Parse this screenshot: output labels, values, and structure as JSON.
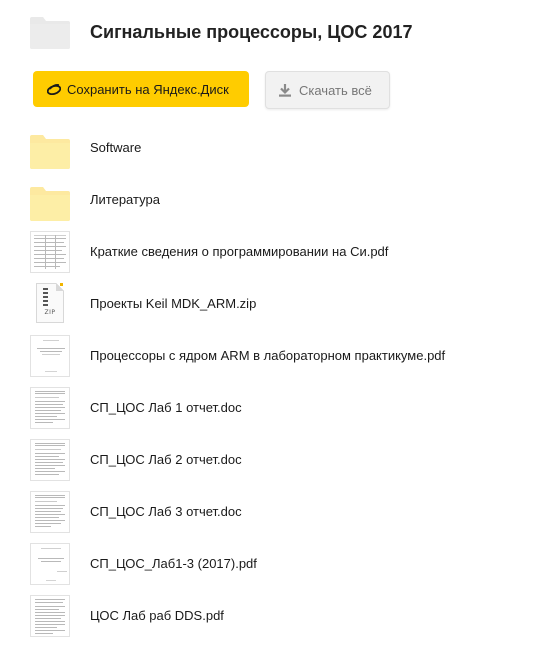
{
  "header": {
    "title": "Сигнальные процессоры, ЦОС 2017",
    "folder_icon": "folder-icon",
    "folder_color": "#e9e9e9"
  },
  "actions": {
    "save_label": "Сохранить на Яндекс.Диск",
    "save_color": "#ffcc00",
    "download_label": "Скачать всё",
    "download_color": "#f2f2f2"
  },
  "files": [
    {
      "name": "Software",
      "type": "folder",
      "icon": "folder-icon"
    },
    {
      "name": "Литература",
      "type": "folder",
      "icon": "folder-icon"
    },
    {
      "name": "Краткие сведения о программировании на Си.pdf",
      "type": "pdf",
      "icon": "document-thumbnail"
    },
    {
      "name": "Проекты Keil MDK_ARM.zip",
      "type": "zip",
      "icon": "zip-archive-icon",
      "icon_label": "ZIP"
    },
    {
      "name": "Процессоры с ядром ARM в лабораторном практикуме.pdf",
      "type": "pdf",
      "icon": "document-thumbnail"
    },
    {
      "name": "СП_ЦОС Лаб 1 отчет.doc",
      "type": "doc",
      "icon": "document-thumbnail"
    },
    {
      "name": "СП_ЦОС Лаб 2 отчет.doc",
      "type": "doc",
      "icon": "document-thumbnail"
    },
    {
      "name": "СП_ЦОС Лаб 3 отчет.doc",
      "type": "doc",
      "icon": "document-thumbnail"
    },
    {
      "name": "СП_ЦОС_Лаб1-3 (2017).pdf",
      "type": "pdf",
      "icon": "document-thumbnail"
    },
    {
      "name": "ЦОС Лаб раб DDS.pdf",
      "type": "pdf",
      "icon": "document-thumbnail"
    }
  ],
  "colors": {
    "folder_yellow": "#fdeea6",
    "folder_yellow_border": "#f5dc7a"
  }
}
